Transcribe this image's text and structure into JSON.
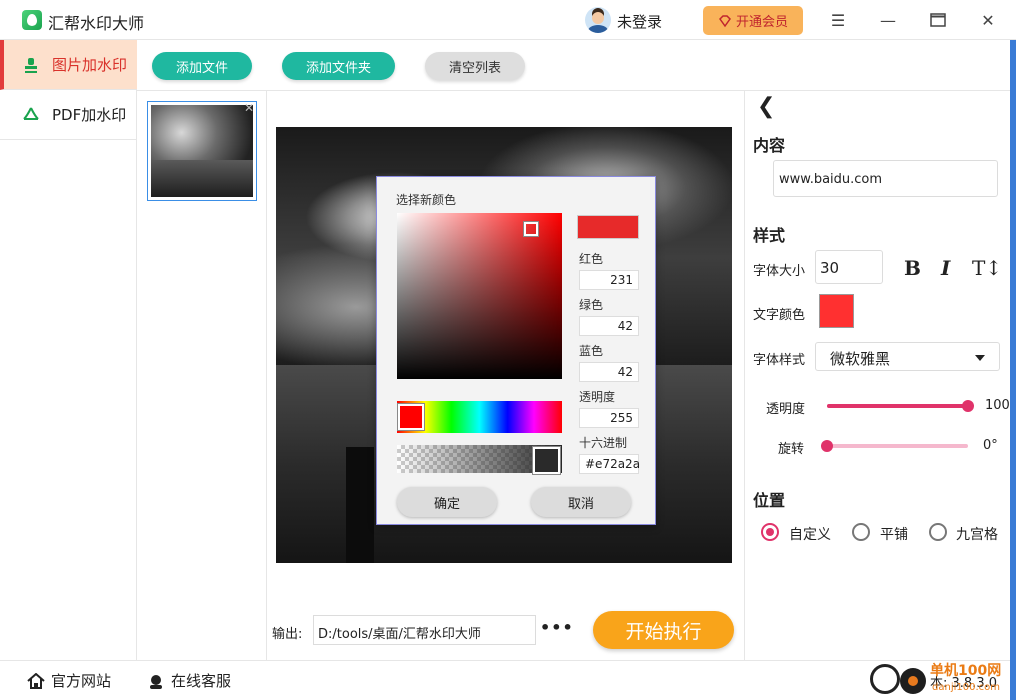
{
  "app": {
    "title": "汇帮水印大师"
  },
  "header": {
    "login_text": "未登录",
    "vip_label": "开通会员"
  },
  "sidebar": {
    "items": [
      {
        "label": "图片加水印",
        "active": true
      },
      {
        "label": "PDF加水印",
        "active": false
      }
    ]
  },
  "toolbar": {
    "add_file": "添加文件",
    "add_folder": "添加文件夹",
    "clear_list": "清空列表"
  },
  "output": {
    "label": "输出:",
    "path": "D:/tools/桌面/汇帮水印大师",
    "more": "•••",
    "start": "开始执行"
  },
  "panel": {
    "content_title": "内容",
    "content_value": "www.baidu.com",
    "style_title": "样式",
    "font_size_label": "字体大小",
    "font_size_value": "30",
    "bold_label": "B",
    "italic_label": "I",
    "textsize_label": "T↕",
    "text_color_label": "文字颜色",
    "text_color": "#ff3030",
    "font_style_label": "字体样式",
    "font_style_value": "微软雅黑",
    "opacity_label": "透明度",
    "opacity_value": "100",
    "opacity_fraction": 1.0,
    "rotate_label": "旋转",
    "rotate_value": "0°",
    "rotate_fraction": 0.0,
    "position_title": "位置",
    "position_options": [
      {
        "label": "自定义",
        "checked": true
      },
      {
        "label": "平铺",
        "checked": false
      },
      {
        "label": "九宫格",
        "checked": false
      }
    ]
  },
  "color_dialog": {
    "title": "选择新颜色",
    "red_label": "红色",
    "red_value": "231",
    "green_label": "绿色",
    "green_value": "42",
    "blue_label": "蓝色",
    "blue_value": "42",
    "alpha_label": "透明度",
    "alpha_value": "255",
    "hex_label": "十六进制",
    "hex_value": "#e72a2a",
    "ok_label": "确定",
    "cancel_label": "取消",
    "selected_color": "#e72a2a"
  },
  "footer": {
    "website": "官方网站",
    "support": "在线客服",
    "version": "本: 3.8.3.0"
  },
  "watermark": {
    "text": "单机100网",
    "sub": "danji100.com"
  },
  "colors": {
    "accent_green": "#1fb8a0",
    "accent_orange": "#f9a41a",
    "accent_pink": "#e0336a",
    "active_red": "#d9322b"
  }
}
